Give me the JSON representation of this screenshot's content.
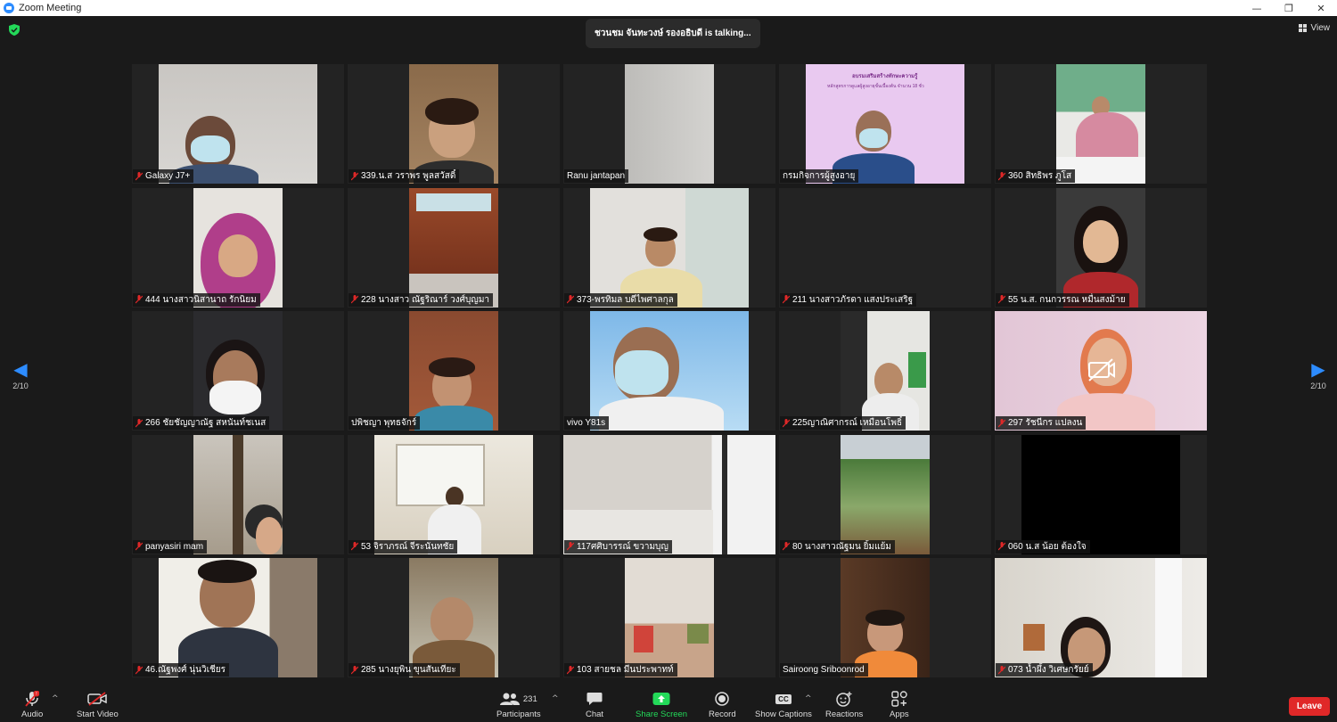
{
  "window": {
    "title": "Zoom Meeting",
    "controls": [
      "—",
      "❐",
      "✕"
    ]
  },
  "meeting": {
    "talking_banner": "ชวนชม จันทะวงษ์ รองอธิบดี is talking...",
    "view_label": "View"
  },
  "pagination": {
    "left": "2/10",
    "right": "2/10"
  },
  "slide": {
    "line1": "อบรมเสริมสร้างทักษะความรู้",
    "line2": "หลักสูตรการดูแลผู้สูงอายุขั้นเบื้องต้น จำนวน 18 ชั่ว"
  },
  "participants": [
    {
      "name": "Galaxy J7+",
      "muted": true
    },
    {
      "name": "339.น.ส วราพร พูลสวัสดิ์",
      "muted": true
    },
    {
      "name": "Ranu jantapan",
      "muted": false
    },
    {
      "name": "กรมกิจการผู้สูงอายุ",
      "muted": false
    },
    {
      "name": "360 สิทธิพร ภูโส",
      "muted": true
    },
    {
      "name": "444 นางสาวนิสานาถ รักนิยม",
      "muted": true
    },
    {
      "name": "228 นางสาว ณัฐริณาร์ วงศ์บุญมา",
      "muted": true
    },
    {
      "name": "373-พรทิมล บดีไพศาลกุล",
      "muted": true
    },
    {
      "name": "211 นางสาวภัรดา แสงประเสริฐ",
      "muted": true
    },
    {
      "name": "55 น.ส. กนกวรรณ หมื่นสงม้าย",
      "muted": true
    },
    {
      "name": "266 ชัยชัญญาณัฐ สหนันท์ชเนส",
      "muted": true
    },
    {
      "name": "ปพิชญา พุทธจักร์",
      "muted": false
    },
    {
      "name": "vivo Y81s",
      "muted": false
    },
    {
      "name": "225ญาณิศากรณ์ เหมือนโพธิ์",
      "muted": true
    },
    {
      "name": "297 รัชนีกร แปลงน",
      "muted": true
    },
    {
      "name": "panyasiri mam",
      "muted": true
    },
    {
      "name": "53 จิราภรณ์ จีระนันทชัย",
      "muted": true
    },
    {
      "name": "117ศศิบารรณ์ ขวามบุญ",
      "muted": true
    },
    {
      "name": "80 นางสาวณัฐมน ยิ้มแย้ม",
      "muted": true
    },
    {
      "name": "060 น.ส น้อย ต้องใจ",
      "muted": true
    },
    {
      "name": "46.ณัฐพงศ์ นุ่นวิเชียร",
      "muted": true
    },
    {
      "name": "285 นางยุพิน ขุนสันเทียะ",
      "muted": true
    },
    {
      "name": "103 สายชล มีนประพาทท์",
      "muted": true
    },
    {
      "name": "Sairoong Sriboonrod",
      "muted": false
    },
    {
      "name": "073 น้ำผึ้ง วิเศษกรัยย์",
      "muted": true
    }
  ],
  "toolbar": {
    "audio": "Audio",
    "audio_badge": "!",
    "start_video": "Start Video",
    "participants": "Participants",
    "participants_count": "231",
    "chat": "Chat",
    "share_screen": "Share Screen",
    "record": "Record",
    "show_captions": "Show Captions",
    "captions_icon": "CC",
    "reactions": "Reactions",
    "apps": "Apps",
    "leave": "Leave"
  },
  "colors": {
    "accent": "#2d8cff",
    "leave": "#e02828",
    "share": "#23d959",
    "muted": "#e02828",
    "slide_bg": "#e9c9f0"
  }
}
